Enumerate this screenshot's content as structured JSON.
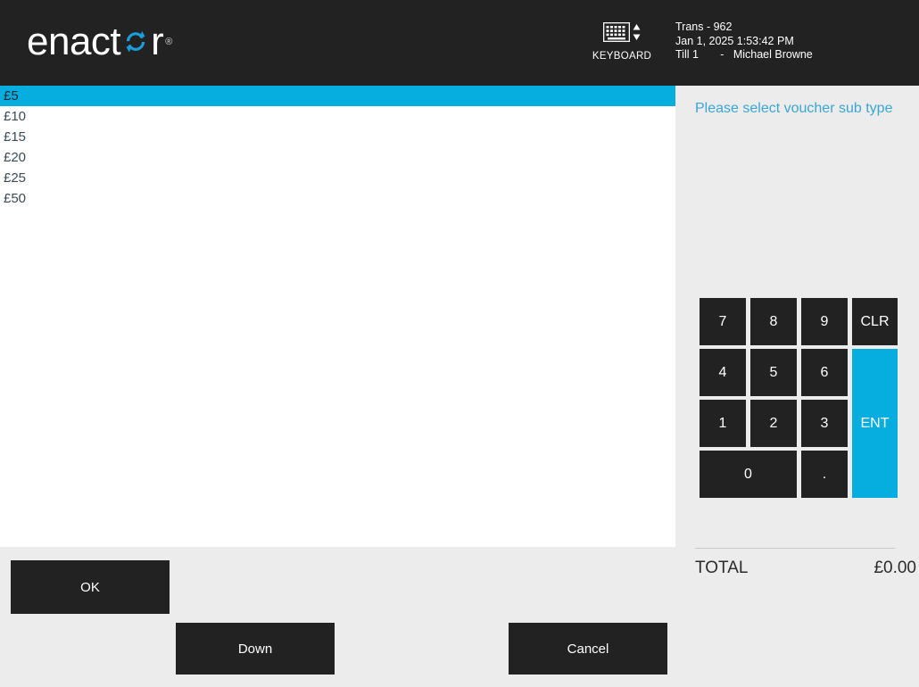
{
  "header": {
    "logo_text_a": "enact",
    "logo_text_b": "r",
    "logo_mark_icon": "circular-arrows-icon",
    "logo_tm": "®",
    "keyboard_icon": "keyboard-icon",
    "keyboard_label": "KEYBOARD",
    "transaction": "Trans - 962",
    "datetime": "Jan 1, 2025 1:53:42 PM",
    "till_operator": "Till 1       -   Michael Browne"
  },
  "list": {
    "selected_index": 0,
    "items": [
      {
        "label": "£5"
      },
      {
        "label": "£10"
      },
      {
        "label": "£15"
      },
      {
        "label": "£20"
      },
      {
        "label": "£25"
      },
      {
        "label": "£50"
      }
    ]
  },
  "buttons": {
    "ok": "OK",
    "down": "Down",
    "cancel": "Cancel"
  },
  "right_panel": {
    "prompt": "Please select voucher sub type",
    "total_label": "TOTAL",
    "total_value": "£0.00"
  },
  "keypad": {
    "keys": [
      {
        "label": "7"
      },
      {
        "label": "8"
      },
      {
        "label": "9"
      },
      {
        "label": "CLR"
      },
      {
        "label": "4"
      },
      {
        "label": "5"
      },
      {
        "label": "6"
      },
      {
        "label": "ENT"
      },
      {
        "label": "1"
      },
      {
        "label": "2"
      },
      {
        "label": "3"
      },
      {
        "label": "0"
      },
      {
        "label": "."
      }
    ]
  },
  "colors": {
    "accent": "#06aee0",
    "dark": "#222222",
    "panel": "#ececec",
    "prompt_text": "#3aa6d4",
    "list_text": "#3b4a57"
  }
}
